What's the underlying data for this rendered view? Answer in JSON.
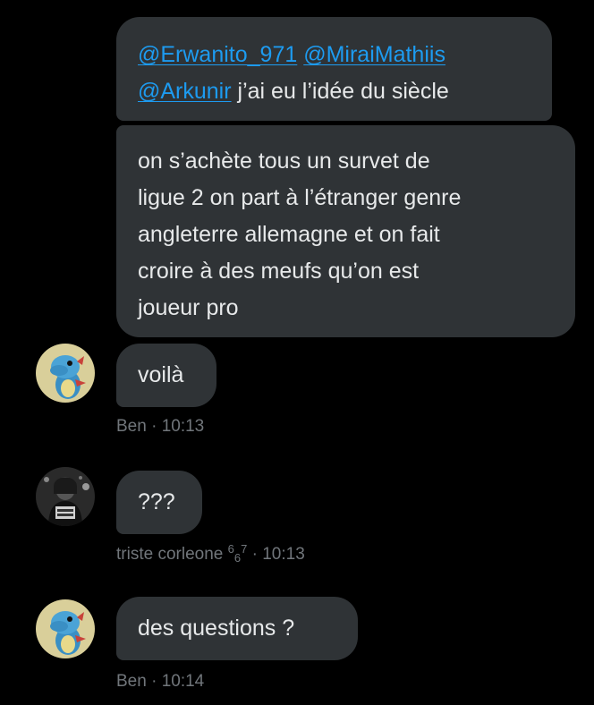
{
  "messages": [
    {
      "id": "m1",
      "mentions": [
        "@Erwanito_971",
        "@MiraiMathiis",
        "@Arkunir"
      ],
      "text": "j’ai eu l’idée du siècle"
    },
    {
      "id": "m2",
      "lines": [
        "on s’achète tous un survet de",
        "ligue 2 on part à l’étranger genre",
        "angleterre allemagne et on fait",
        "croire à des meufs qu’on est",
        "joueur pro"
      ]
    },
    {
      "id": "m3",
      "text": "voilà",
      "sender": "Ben",
      "time": "· 10:13",
      "avatar": "totodile-avatar"
    },
    {
      "id": "m4",
      "text": "???",
      "sender": "triste corleone",
      "sender_sup": "6",
      "sender_sub": "6",
      "sender_sup2": "7",
      "time": "· 10:13",
      "avatar": "hooded-person-avatar"
    },
    {
      "id": "m5",
      "text": "des questions ?",
      "sender": "Ben",
      "time": "· 10:14",
      "avatar": "totodile-avatar"
    }
  ],
  "colors": {
    "background": "#000000",
    "bubble": "#2f3336",
    "text": "#e7e9ea",
    "mention": "#1d9bf0",
    "meta": "#71767b"
  }
}
